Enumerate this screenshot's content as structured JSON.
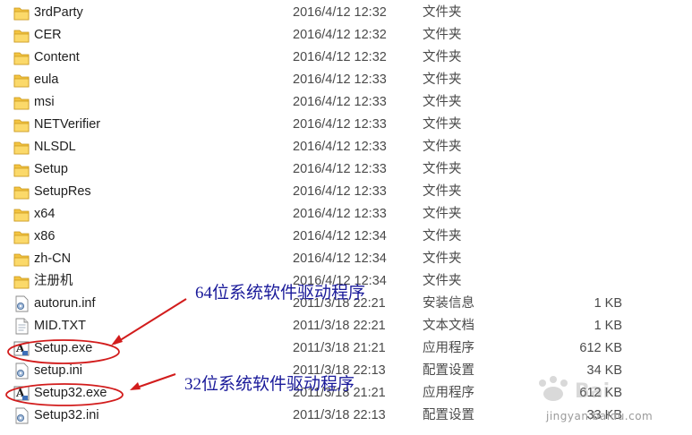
{
  "files": [
    {
      "name": "3rdParty",
      "date": "2016/4/12 12:32",
      "type": "文件夹",
      "size": "",
      "icon": "folder-icon"
    },
    {
      "name": "CER",
      "date": "2016/4/12 12:32",
      "type": "文件夹",
      "size": "",
      "icon": "folder-icon"
    },
    {
      "name": "Content",
      "date": "2016/4/12 12:32",
      "type": "文件夹",
      "size": "",
      "icon": "folder-icon"
    },
    {
      "name": "eula",
      "date": "2016/4/12 12:33",
      "type": "文件夹",
      "size": "",
      "icon": "folder-icon"
    },
    {
      "name": "msi",
      "date": "2016/4/12 12:33",
      "type": "文件夹",
      "size": "",
      "icon": "folder-icon"
    },
    {
      "name": "NETVerifier",
      "date": "2016/4/12 12:33",
      "type": "文件夹",
      "size": "",
      "icon": "folder-icon"
    },
    {
      "name": "NLSDL",
      "date": "2016/4/12 12:33",
      "type": "文件夹",
      "size": "",
      "icon": "folder-icon"
    },
    {
      "name": "Setup",
      "date": "2016/4/12 12:33",
      "type": "文件夹",
      "size": "",
      "icon": "folder-icon"
    },
    {
      "name": "SetupRes",
      "date": "2016/4/12 12:33",
      "type": "文件夹",
      "size": "",
      "icon": "folder-icon"
    },
    {
      "name": "x64",
      "date": "2016/4/12 12:33",
      "type": "文件夹",
      "size": "",
      "icon": "folder-icon"
    },
    {
      "name": "x86",
      "date": "2016/4/12 12:34",
      "type": "文件夹",
      "size": "",
      "icon": "folder-icon"
    },
    {
      "name": "zh-CN",
      "date": "2016/4/12 12:34",
      "type": "文件夹",
      "size": "",
      "icon": "folder-icon"
    },
    {
      "name": "注册机",
      "date": "2016/4/12 12:34",
      "type": "文件夹",
      "size": "",
      "icon": "folder-icon"
    },
    {
      "name": "autorun.inf",
      "date": "2011/3/18 22:21",
      "type": "安装信息",
      "size": "1 KB",
      "icon": "setup-info-icon"
    },
    {
      "name": "MID.TXT",
      "date": "2011/3/18 22:21",
      "type": "文本文档",
      "size": "1 KB",
      "icon": "text-file-icon"
    },
    {
      "name": "Setup.exe",
      "date": "2011/3/18 21:21",
      "type": "应用程序",
      "size": "612 KB",
      "icon": "installer-exe-icon"
    },
    {
      "name": "setup.ini",
      "date": "2011/3/18 22:13",
      "type": "配置设置",
      "size": "34 KB",
      "icon": "config-file-icon"
    },
    {
      "name": "Setup32.exe",
      "date": "2011/3/18 21:21",
      "type": "应用程序",
      "size": "612 KB",
      "icon": "installer-exe-icon"
    },
    {
      "name": "Setup32.ini",
      "date": "2011/3/18 22:13",
      "type": "配置设置",
      "size": "33 KB",
      "icon": "config-file-icon"
    }
  ],
  "annotations": {
    "note_64": "64位系统软件驱动程序",
    "note_32": "32位系统软件驱动程序"
  },
  "colors": {
    "annotation_red": "#d21c1c",
    "annotation_text": "#1a1a9a",
    "folder_yellow": "#f3c441"
  },
  "watermark": {
    "text": "jingyan.baidu.com",
    "logo": "baidu-jingyan-logo"
  }
}
